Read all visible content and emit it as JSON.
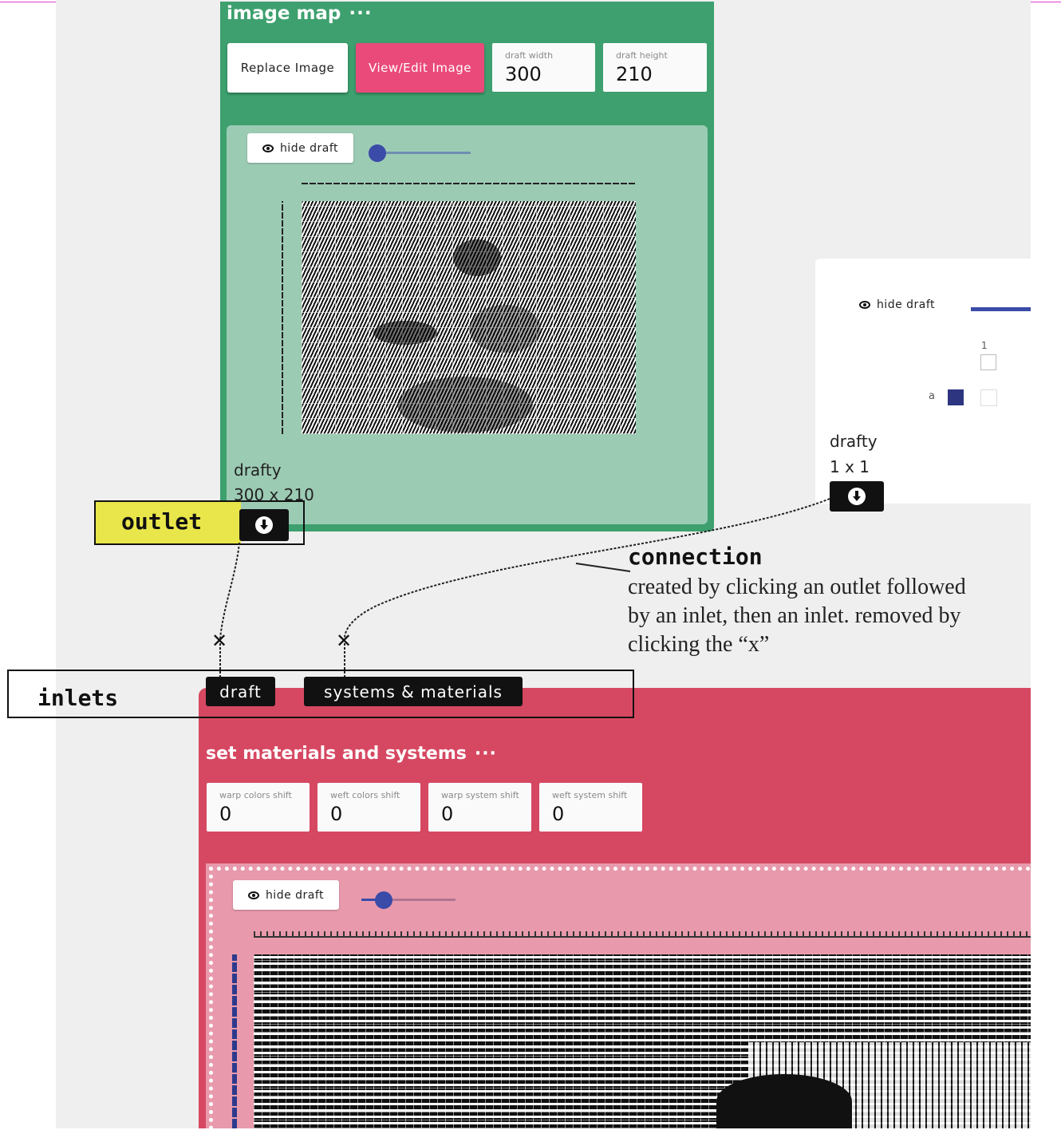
{
  "image_map": {
    "title": "image map",
    "more": "···",
    "replace_label": "Replace Image",
    "view_edit_label": "View/Edit Image",
    "width_label": "draft width",
    "width_value": "300",
    "height_label": "draft height",
    "height_value": "210",
    "hide_label": "hide draft",
    "draft_name": "drafty",
    "draft_size": "300 x 210"
  },
  "drafty_card": {
    "hide_label": "hide draft",
    "col_num": "1",
    "row_label": "a",
    "draft_name": "drafty",
    "draft_size": "1 x 1"
  },
  "annotations": {
    "outlet": "outlet",
    "inlets": "inlets",
    "connection_title": "connection",
    "connection_desc_1": "created by clicking an outlet followed",
    "connection_desc_2": "by an inlet, then an inlet. removed by",
    "connection_desc_3": "clicking the “x”",
    "close_glyph": "✕"
  },
  "set_materials": {
    "inlet_draft": "draft",
    "inlet_systems": "systems & materials",
    "title": "set materials and systems",
    "more": "···",
    "fields": [
      {
        "label": "warp colors shift",
        "value": "0"
      },
      {
        "label": "weft colors shift",
        "value": "0"
      },
      {
        "label": "warp system shift",
        "value": "0"
      },
      {
        "label": "weft system shift",
        "value": "0"
      }
    ],
    "hide_label": "hide draft"
  },
  "colors": {
    "image_map_bg": "#3da06e",
    "set_materials_bg": "#d64862",
    "accent_pink": "#ea4a7a",
    "slider_blue": "#3a4ba8",
    "outlet_highlight": "#e8e64a"
  }
}
